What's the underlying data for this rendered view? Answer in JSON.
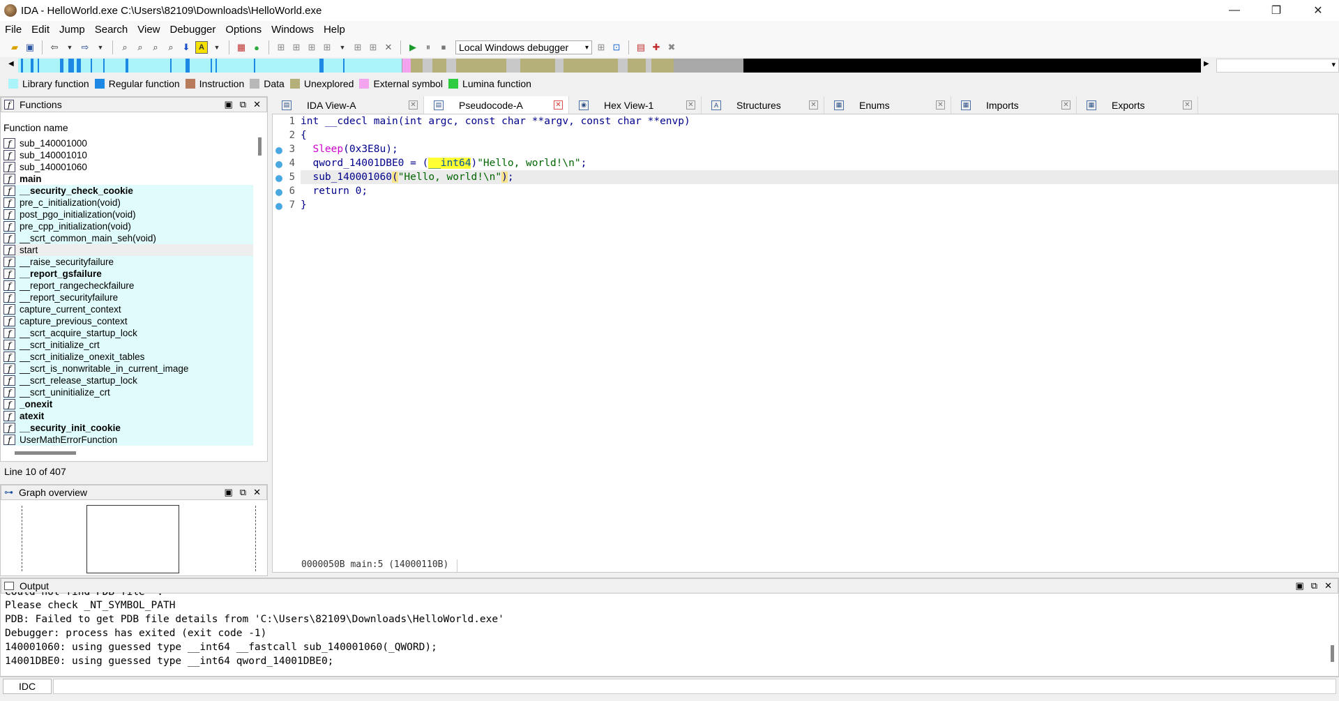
{
  "window": {
    "title": "IDA - HelloWorld.exe C:\\Users\\82109\\Downloads\\HelloWorld.exe",
    "minimize": "—",
    "restore": "❐",
    "close": "✕"
  },
  "menu": [
    "File",
    "Edit",
    "Jump",
    "Search",
    "View",
    "Debugger",
    "Options",
    "Windows",
    "Help"
  ],
  "toolbar": {
    "debugger_select": "Local Windows debugger"
  },
  "legend": [
    {
      "label": "Library function",
      "color": "#aaf4fa"
    },
    {
      "label": "Regular function",
      "color": "#1e88e5"
    },
    {
      "label": "Instruction",
      "color": "#b87b5c"
    },
    {
      "label": "Data",
      "color": "#b8b8b8"
    },
    {
      "label": "Unexplored",
      "color": "#b5b07a"
    },
    {
      "label": "External symbol",
      "color": "#f2a4ef"
    },
    {
      "label": "Lumina function",
      "color": "#2ecc40"
    }
  ],
  "functions": {
    "title": "Functions",
    "column_header": "Function name",
    "items": [
      {
        "name": "sub_140001000",
        "bold": false,
        "style": "plain"
      },
      {
        "name": "sub_140001010",
        "bold": false,
        "style": "plain"
      },
      {
        "name": "sub_140001060",
        "bold": false,
        "style": "plain"
      },
      {
        "name": "main",
        "bold": true,
        "style": "plain"
      },
      {
        "name": "__security_check_cookie",
        "bold": true,
        "style": "lib"
      },
      {
        "name": "pre_c_initialization(void)",
        "bold": false,
        "style": "lib"
      },
      {
        "name": "post_pgo_initialization(void)",
        "bold": false,
        "style": "lib"
      },
      {
        "name": "pre_cpp_initialization(void)",
        "bold": false,
        "style": "lib"
      },
      {
        "name": "__scrt_common_main_seh(void)",
        "bold": false,
        "style": "lib"
      },
      {
        "name": "start",
        "bold": false,
        "style": "sel"
      },
      {
        "name": "__raise_securityfailure",
        "bold": false,
        "style": "lib"
      },
      {
        "name": "__report_gsfailure",
        "bold": true,
        "style": "lib"
      },
      {
        "name": "__report_rangecheckfailure",
        "bold": false,
        "style": "lib"
      },
      {
        "name": "__report_securityfailure",
        "bold": false,
        "style": "lib"
      },
      {
        "name": "capture_current_context",
        "bold": false,
        "style": "lib"
      },
      {
        "name": "capture_previous_context",
        "bold": false,
        "style": "lib"
      },
      {
        "name": "__scrt_acquire_startup_lock",
        "bold": false,
        "style": "lib"
      },
      {
        "name": "__scrt_initialize_crt",
        "bold": false,
        "style": "lib"
      },
      {
        "name": "__scrt_initialize_onexit_tables",
        "bold": false,
        "style": "lib"
      },
      {
        "name": "__scrt_is_nonwritable_in_current_image",
        "bold": false,
        "style": "lib"
      },
      {
        "name": "__scrt_release_startup_lock",
        "bold": false,
        "style": "lib"
      },
      {
        "name": "__scrt_uninitialize_crt",
        "bold": false,
        "style": "lib"
      },
      {
        "name": "_onexit",
        "bold": true,
        "style": "lib"
      },
      {
        "name": "atexit",
        "bold": true,
        "style": "lib"
      },
      {
        "name": "__security_init_cookie",
        "bold": true,
        "style": "lib"
      },
      {
        "name": "UserMathErrorFunction",
        "bold": false,
        "style": "lib"
      }
    ],
    "status": "Line 10 of 407"
  },
  "graph_overview": {
    "title": "Graph overview"
  },
  "tabs": [
    {
      "label": "IDA View-A",
      "icon": "ida-view-icon",
      "active": false
    },
    {
      "label": "Pseudocode-A",
      "icon": "pseudocode-icon",
      "active": true
    },
    {
      "label": "Hex View-1",
      "icon": "hex-view-icon",
      "active": false
    },
    {
      "label": "Structures",
      "icon": "structures-icon",
      "active": false
    },
    {
      "label": "Enums",
      "icon": "enums-icon",
      "active": false
    },
    {
      "label": "Imports",
      "icon": "imports-icon",
      "active": false
    },
    {
      "label": "Exports",
      "icon": "exports-icon",
      "active": false
    }
  ],
  "pseudocode": {
    "line_numbers": [
      "1",
      "2",
      "3",
      "4",
      "5",
      "6",
      "7"
    ],
    "lines": {
      "l1": {
        "kw": "int",
        "rest": " __cdecl main(int argc, const char **argv, const char **envp)"
      },
      "l2": "{",
      "l3": {
        "fn": "Sleep",
        "rest": "(0x3E8u);"
      },
      "l4": {
        "var": "qword_14001DBE0",
        "mid": " = (",
        "type": "__int64",
        "close": ")",
        "str": "\"Hello, world!\\n\"",
        "end": ";"
      },
      "l5": {
        "fn": "sub_140001060",
        "open": "(",
        "str": "\"Hello, world!\\n\"",
        "close": ")",
        "end": ";"
      },
      "l6": {
        "kw": "return",
        "rest": " 0;"
      },
      "l7": "}"
    },
    "status": "0000050B main:5 (14000110B)"
  },
  "output": {
    "title": "Output",
    "lines": [
      "Could not find PDB file  .",
      "Please check _NT_SYMBOL_PATH",
      "PDB: Failed to get PDB file details from 'C:\\Users\\82109\\Downloads\\HelloWorld.exe'",
      "Debugger: process has exited (exit code -1)",
      "140001060: using guessed type __int64 __fastcall sub_140001060(_QWORD);",
      "14001DBE0: using guessed type __int64 qword_14001DBE0;"
    ]
  },
  "idc": {
    "button": "IDC"
  }
}
